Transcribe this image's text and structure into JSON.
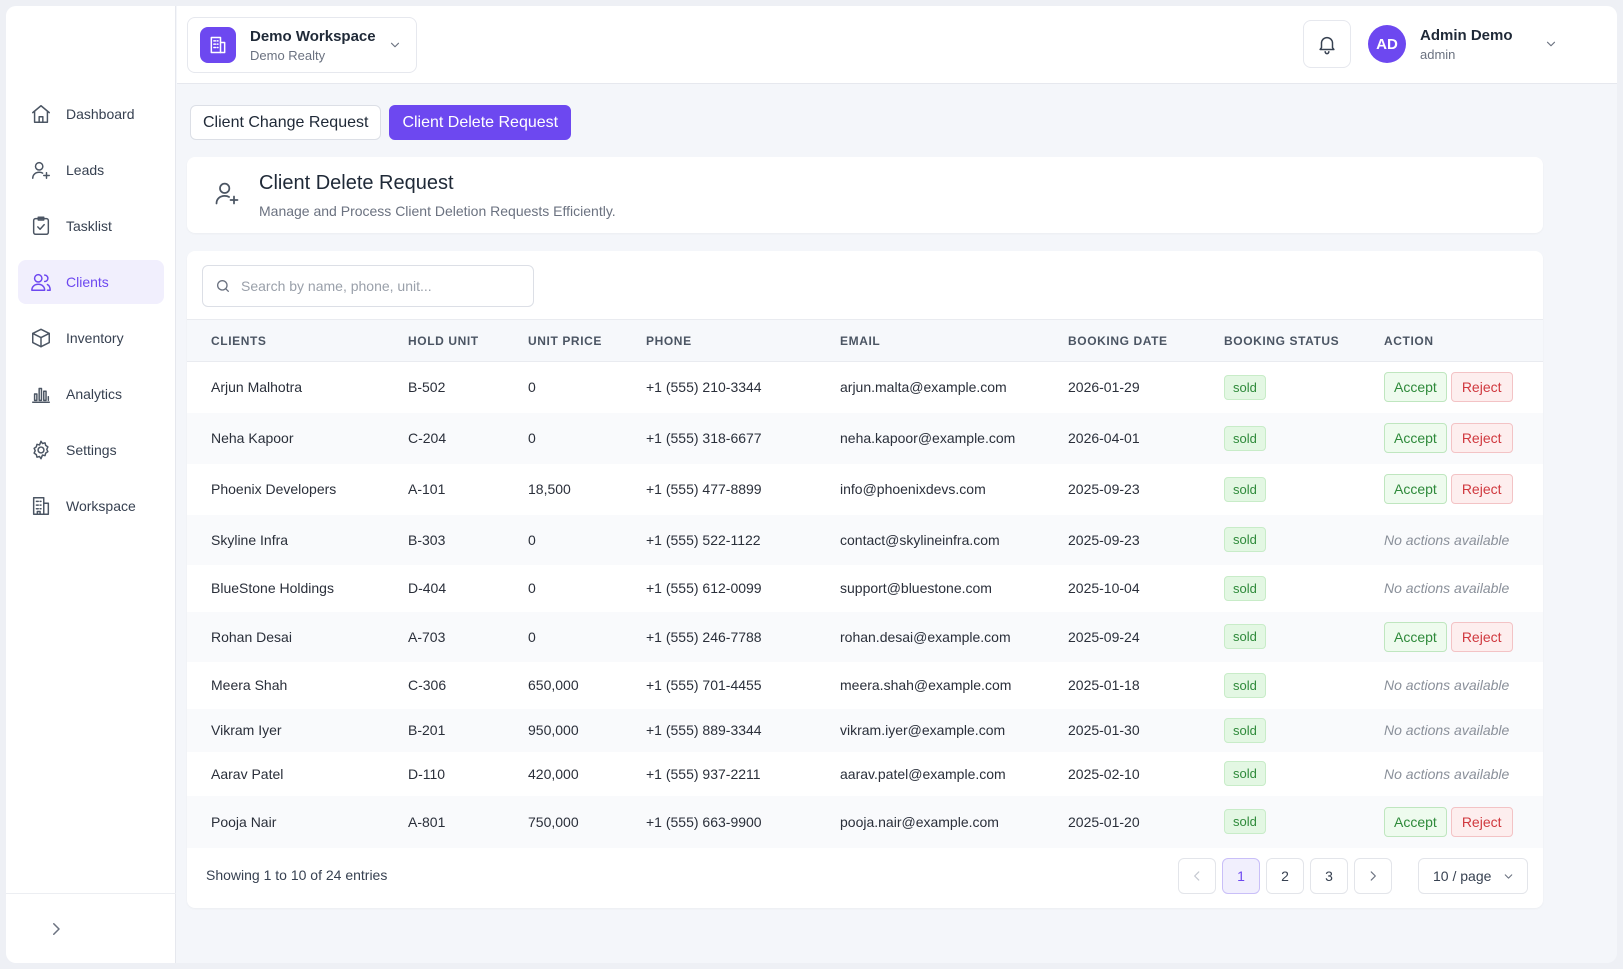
{
  "sidebar": {
    "items": [
      {
        "label": "Dashboard",
        "icon": "home-icon"
      },
      {
        "label": "Leads",
        "icon": "user-plus-icon"
      },
      {
        "label": "Tasklist",
        "icon": "clipboard-check-icon"
      },
      {
        "label": "Clients",
        "icon": "users-icon",
        "active": true
      },
      {
        "label": "Inventory",
        "icon": "box-icon"
      },
      {
        "label": "Analytics",
        "icon": "bar-chart-icon"
      },
      {
        "label": "Settings",
        "icon": "gear-icon"
      },
      {
        "label": "Workspace",
        "icon": "building-icon"
      }
    ]
  },
  "header": {
    "workspace_name": "Demo Workspace",
    "workspace_sub": "Demo Realty",
    "user_initials": "AD",
    "user_name": "Admin Demo",
    "user_role": "admin"
  },
  "tabs": {
    "change": "Client Change Request",
    "delete": "Client Delete Request"
  },
  "info": {
    "title": "Client Delete Request",
    "subtitle": "Manage and Process Client Deletion Requests Efficiently."
  },
  "search": {
    "placeholder": "Search by name, phone, unit..."
  },
  "table": {
    "headers": [
      "CLIENTS",
      "HOLD UNIT",
      "UNIT PRICE",
      "PHONE",
      "EMAIL",
      "BOOKING DATE",
      "BOOKING STATUS",
      "ACTION"
    ],
    "accept_label": "Accept",
    "reject_label": "Reject",
    "no_actions_label": "No actions available",
    "rows": [
      {
        "client": "Arjun Malhotra",
        "unit": "B-502",
        "price": "0",
        "phone": "+1 (555) 210-3344",
        "email": "arjun.malta@example.com",
        "date": "2026-01-29",
        "status": "sold",
        "actions": true
      },
      {
        "client": "Neha Kapoor",
        "unit": "C-204",
        "price": "0",
        "phone": "+1 (555) 318-6677",
        "email": "neha.kapoor@example.com",
        "date": "2026-04-01",
        "status": "sold",
        "actions": true
      },
      {
        "client": "Phoenix Developers",
        "unit": "A-101",
        "price": "18,500",
        "phone": "+1 (555) 477-8899",
        "email": "info@phoenixdevs.com",
        "date": "2025-09-23",
        "status": "sold",
        "actions": true
      },
      {
        "client": "Skyline Infra",
        "unit": "B-303",
        "price": "0",
        "phone": "+1 (555) 522-1122",
        "email": "contact@skylineinfra.com",
        "date": "2025-09-23",
        "status": "sold",
        "actions": false
      },
      {
        "client": "BlueStone Holdings",
        "unit": "D-404",
        "price": "0",
        "phone": "+1 (555) 612-0099",
        "email": "support@bluestone.com",
        "date": "2025-10-04",
        "status": "sold",
        "actions": false
      },
      {
        "client": "Rohan Desai",
        "unit": "A-703",
        "price": "0",
        "phone": "+1 (555) 246-7788",
        "email": "rohan.desai@example.com",
        "date": "2025-09-24",
        "status": "sold",
        "actions": true
      },
      {
        "client": "Meera Shah",
        "unit": "C-306",
        "price": "650,000",
        "phone": "+1 (555) 701-4455",
        "email": "meera.shah@example.com",
        "date": "2025-01-18",
        "status": "sold",
        "actions": false
      },
      {
        "client": "Vikram Iyer",
        "unit": "B-201",
        "price": "950,000",
        "phone": "+1 (555) 889-3344",
        "email": "vikram.iyer@example.com",
        "date": "2025-01-30",
        "status": "sold",
        "actions": false
      },
      {
        "client": "Aarav Patel",
        "unit": "D-110",
        "price": "420,000",
        "phone": "+1 (555) 937-2211",
        "email": "aarav.patel@example.com",
        "date": "2025-02-10",
        "status": "sold",
        "actions": false
      },
      {
        "client": "Pooja Nair",
        "unit": "A-801",
        "price": "750,000",
        "phone": "+1 (555) 663-9900",
        "email": "pooja.nair@example.com",
        "date": "2025-01-20",
        "status": "sold",
        "actions": true
      }
    ],
    "row_heights": [
      51,
      51,
      51,
      50,
      47,
      50,
      47,
      43,
      44,
      52
    ]
  },
  "pagination": {
    "summary": "Showing 1 to 10 of 24 entries",
    "pages": [
      "1",
      "2",
      "3"
    ],
    "current": "1",
    "per_page": "10 / page"
  },
  "colors": {
    "accent": "#6d48f0",
    "sold": "#2e8a3a",
    "reject": "#d0383e"
  }
}
